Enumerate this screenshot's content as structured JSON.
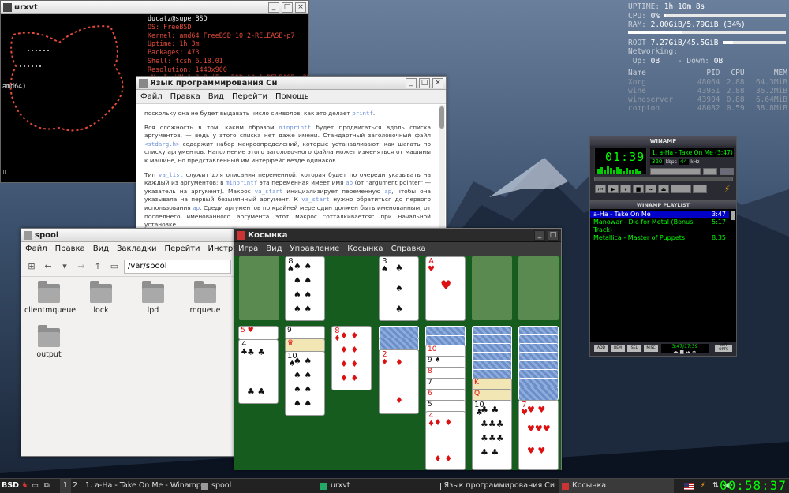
{
  "conky": {
    "uptime_label": "UPTIME:",
    "uptime": "1h 10m 8s",
    "cpu_label": "CPU:",
    "cpu": "0%",
    "cpu_fraction": 0.0,
    "ram_label": "RAM:",
    "ram": "2.00GiB/5.79GiB (34%)",
    "ram_fraction": 0.34,
    "root_label": "ROOT",
    "root": "7.27GiB/45.5GiB",
    "root_fraction": 0.16,
    "net_label": "Networking:",
    "up_label": "Up:",
    "up": "0B",
    "down_label": "- Down:",
    "down": "0B",
    "proc_headers": [
      "Name",
      "PID",
      "CPU",
      "MEM"
    ],
    "procs": [
      [
        "Xorg",
        "48064",
        "2.88",
        "64.3MiB"
      ],
      [
        "wine",
        "43951",
        "2.88",
        "36.2MiB"
      ],
      [
        "wineserver",
        "43904",
        "0.88",
        "6.64MiB"
      ],
      [
        "compton",
        "48082",
        "0.59",
        "38.8MiB"
      ]
    ]
  },
  "urxvt": {
    "title": "urxvt",
    "user": "ducatz@superBSD",
    "info": [
      "OS: FreeBSD",
      "Kernel: amd64 FreeBSD 10.2-RELEASE-p7",
      "Uptime: 1h 3m",
      "Packages: 473",
      "Shell: tcsh 6.18.01",
      "Resolution: 1440x900",
      "WM: IceWM 1.3.8 (FreeBSD 10.1-RELEASE-p25/"
    ],
    "wrap_text": "amd64)",
    "cursor": "▯"
  },
  "doc": {
    "title": "Язык программирования Си",
    "menu": [
      "Файл",
      "Правка",
      "Вид",
      "Перейти",
      "Помощь"
    ],
    "p1a": "поскольку она не будет выдавать число символов, как это делает ",
    "p1code": "printf",
    "p1b": ".",
    "p2a": "Вся сложность в том, каким образом ",
    "p2code1": "minprintf",
    "p2b": " будет продвигаться вдоль списка аргументов, — ведь у этого списка нет даже имени. Стандартный заголовочный файл ",
    "p2code2": "<stdarg.h>",
    "p2c": " содержит набор макроопределений, которые устанавливают, как шагать по списку аргументов. Наполнение этого заголовочного файла может изменяться от машины к машине, но представленный им интерфейс везде одинаков.",
    "p3a": "Тип ",
    "p3code1": "va_list",
    "p3b": " служит для описания переменной, которая будет по очереди указывать на каждый из аргументов; в ",
    "p3code2": "minprintf",
    "p3c": " эта переменная имеет имя ",
    "p3code3": "ap",
    "p3d": " (от \"argument pointer\" — указатель на аргумент). Макрос ",
    "p3code4": "va_start",
    "p3e": " инициализирует переменную ",
    "p3code5": "ap",
    "p3f": ", чтобы она указывала на первый безымянный аргумент. К ",
    "p3code6": "va_start",
    "p3g": " нужно обратиться до первого использования ",
    "p3code7": "ap",
    "p3h": ". Среди аргументов по крайней мере один должен быть именованным; от последнего именованного аргумента этот макрос \"отталкивается\" при начальной установке."
  },
  "spool": {
    "title": "spool",
    "menu": [
      "Файл",
      "Правка",
      "Вид",
      "Закладки",
      "Перейти",
      "Инструменты"
    ],
    "path": "/var/spool",
    "folders": [
      "clientmqueue",
      "lock",
      "lpd",
      "mqueue",
      "output"
    ]
  },
  "solitaire": {
    "title": "Косынка",
    "menu": [
      "Игра",
      "Вид",
      "Управление",
      "Косынка",
      "Справка"
    ]
  },
  "winamp": {
    "title": "WINAMP",
    "time": "01:39",
    "now_playing": "1. a-Ha - Take On Me (3:47)",
    "kbps": "320",
    "kbps_label": "kbps",
    "khz": "44",
    "khz_label": "kHz",
    "playlist_title": "WINAMP PLAYLIST",
    "playlist": [
      {
        "name": "a-Ha - Take On Me",
        "time": "3:47"
      },
      {
        "name": "Manowar - Die for Metal (Bonus Track)",
        "time": "5:17"
      },
      {
        "name": "Metallica - Master of Puppets",
        "time": "8:35"
      }
    ],
    "pl_buttons": [
      "ADD",
      "REM",
      "SEL",
      "MISC",
      "LIST OPTS"
    ],
    "pl_time": "3:47/17:39"
  },
  "taskbar": {
    "start": "BSD",
    "workspaces": [
      "1",
      "2"
    ],
    "tasks": [
      "1. a-Ha - Take On Me - Winamp",
      "spool",
      "urxvt",
      "Язык программирования Си",
      "Косынка"
    ],
    "clock": "00:58:37"
  }
}
